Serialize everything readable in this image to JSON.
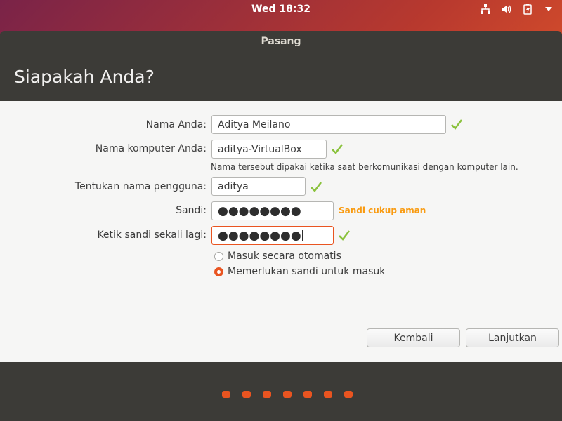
{
  "topbar": {
    "clock": "Wed 18:32",
    "icons": [
      "network-icon",
      "volume-icon",
      "battery-icon",
      "system-menu-arrow-icon"
    ]
  },
  "window": {
    "title": "Pasang",
    "header": "Siapakah Anda?"
  },
  "form": {
    "name_label": "Nama Anda:",
    "name_value": "Aditya Meilano",
    "computer_label": "Nama komputer Anda:",
    "computer_value": "aditya-VirtualBox",
    "computer_hint": "Nama tersebut dipakai ketika saat berkomunikasi dengan komputer lain.",
    "username_label": "Tentukan nama pengguna:",
    "username_value": "aditya",
    "password_label": "Sandi:",
    "password_value": "●●●●●●●●",
    "password_strength": "Sandi cukup aman",
    "confirm_label": "Ketik sandi sekali lagi:",
    "confirm_value": "●●●●●●●●",
    "login_options": [
      {
        "label": "Masuk secara otomatis",
        "selected": false
      },
      {
        "label": "Memerlukan sandi untuk masuk",
        "selected": true
      }
    ]
  },
  "buttons": {
    "back": "Kembali",
    "continue": "Lanjutkan"
  },
  "progress": {
    "steps": 7
  },
  "colors": {
    "accent": "#e95420",
    "check": "#8ac23c",
    "strength": "#f99b11",
    "window_dark": "#3c3b37"
  }
}
